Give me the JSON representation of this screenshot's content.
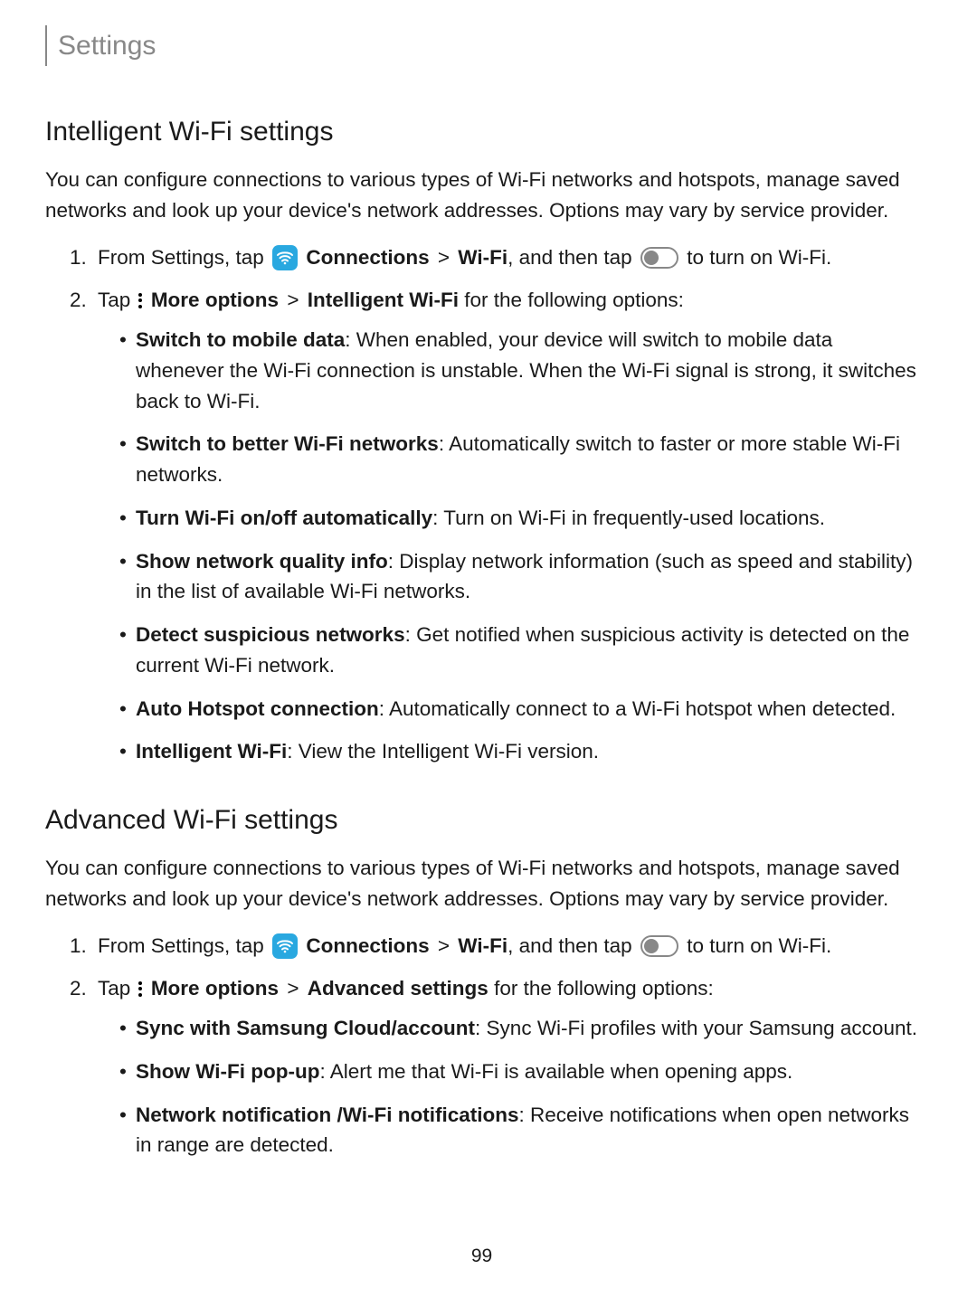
{
  "header": "Settings",
  "pageNumber": "99",
  "sep": ">",
  "section1": {
    "title": "Intelligent Wi-Fi settings",
    "intro": "You can configure connections to various types of Wi-Fi networks and hotspots, manage saved networks and look up your device's network addresses. Options may vary by service provider.",
    "step1": {
      "pre": "From Settings, tap",
      "conn": "Connections",
      "wifi": "Wi-Fi",
      "mid": ", and then tap",
      "post": "to turn on Wi-Fi."
    },
    "step2": {
      "pre": "Tap",
      "more": "More options",
      "target": "Intelligent Wi-Fi",
      "post": "for the following options:"
    },
    "bullets": [
      {
        "term": "Switch to mobile data",
        "desc": ": When enabled, your device will switch to mobile data whenever the Wi-Fi connection is unstable. When the Wi-Fi signal is strong, it switches back to Wi-Fi."
      },
      {
        "term": "Switch to better Wi-Fi networks",
        "desc": ": Automatically switch to faster or more stable Wi-Fi networks."
      },
      {
        "term": "Turn Wi-Fi on/off automatically",
        "desc": ": Turn on Wi-Fi in frequently-used locations."
      },
      {
        "term": "Show network quality info",
        "desc": ": Display network information (such as speed and stability) in the list of available Wi-Fi networks."
      },
      {
        "term": "Detect suspicious networks",
        "desc": ": Get notified when suspicious activity is detected on the current Wi-Fi network."
      },
      {
        "term": "Auto Hotspot connection",
        "desc": ": Automatically connect to a Wi-Fi hotspot when detected."
      },
      {
        "term": "Intelligent Wi-Fi",
        "desc": ": View the Intelligent Wi-Fi version."
      }
    ]
  },
  "section2": {
    "title": "Advanced Wi-Fi settings",
    "intro": "You can configure connections to various types of Wi-Fi networks and hotspots, manage saved networks and look up your device's network addresses. Options may vary by service provider.",
    "step1": {
      "pre": "From Settings, tap",
      "conn": "Connections",
      "wifi": "Wi-Fi",
      "mid": ", and then tap",
      "post": "to turn on Wi-Fi."
    },
    "step2": {
      "pre": "Tap",
      "more": "More options",
      "target": "Advanced settings",
      "post": "for the following options:"
    },
    "bullets": [
      {
        "term": "Sync with Samsung Cloud/account",
        "desc": ": Sync Wi-Fi profiles with your Samsung account."
      },
      {
        "term": "Show Wi-Fi pop-up",
        "desc": ": Alert me that Wi-Fi is available when opening apps."
      },
      {
        "term": "Network notification /Wi-Fi notifications",
        "desc": ": Receive notifications when open networks in range are detected."
      }
    ]
  }
}
